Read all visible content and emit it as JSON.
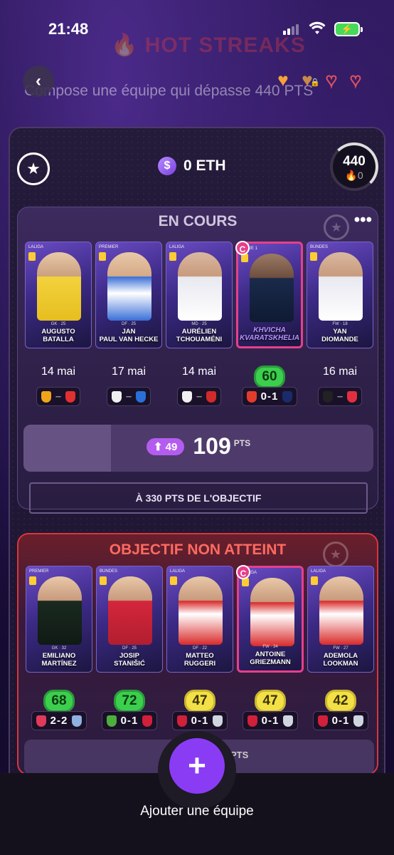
{
  "status_bar": {
    "time": "21:48"
  },
  "header": {
    "mode_title": "🔥 HOT STREAKS",
    "subtitle": "Compose une équipe qui dépasse 440 PTS"
  },
  "hearts": [
    "full",
    "half-locked",
    "empty",
    "empty"
  ],
  "panel": {
    "balance": "0 ETH",
    "gauge_score": "440",
    "gauge_streak": "🔥0"
  },
  "team1": {
    "status": "EN COURS",
    "cards": [
      {
        "name": "AUGUSTO\nBATALLA",
        "league": "LALIGA",
        "meta": "GK · 25",
        "photo": "yellow",
        "captain": false
      },
      {
        "name": "JAN\nPAUL VAN HECKE",
        "league": "PREMIER",
        "meta": "DF · 25",
        "photo": "blue",
        "captain": false
      },
      {
        "name": "AURÉLIEN\nTCHOUAMÉNI",
        "league": "LALIGA",
        "meta": "MD · 25",
        "photo": "white",
        "captain": false
      },
      {
        "name": "KHVICHA\nKVARATSKHELIA",
        "league": "LIGUE 1",
        "meta": "",
        "photo": "dark",
        "captain": true
      },
      {
        "name": "YAN\nDIOMANDE",
        "league": "BUNDES",
        "meta": "FW · 18",
        "photo": "white",
        "captain": false
      }
    ],
    "results": [
      {
        "type": "date",
        "value": "14 mai"
      },
      {
        "type": "date",
        "value": "17 mai"
      },
      {
        "type": "date",
        "value": "14 mai"
      },
      {
        "type": "score-green",
        "value": "60"
      },
      {
        "type": "date",
        "value": "16 mai"
      }
    ],
    "matches": [
      {
        "home": "#f2a51a",
        "away": "#e03030",
        "score": ""
      },
      {
        "home": "#f0f0f0",
        "away": "#2a6fd8",
        "score": ""
      },
      {
        "home": "#f0f0f0",
        "away": "#d02a2a",
        "score": ""
      },
      {
        "home": "#e33c2c",
        "away": "#1a2b6b",
        "score": "0-1"
      },
      {
        "home": "#222222",
        "away": "#e03040",
        "score": ""
      }
    ],
    "points_delta": "49",
    "points_total": "109",
    "points_unit": "PTS",
    "points_progress_pct": 25,
    "objective_text": "À 330 PTS DE L'OBJECTIF"
  },
  "team2": {
    "status": "OBJECTIF NON ATTEINT",
    "cards": [
      {
        "name": "EMILIANO\nMARTÍNEZ",
        "league": "PREMIER",
        "meta": "GK · 32",
        "photo": "green",
        "captain": false
      },
      {
        "name": "JOSIP\nSTANIŠIĆ",
        "league": "BUNDES",
        "meta": "DF · 25",
        "photo": "redsolid",
        "captain": false
      },
      {
        "name": "MATTEO\nRUGGERI",
        "league": "LALIGA",
        "meta": "DF · 22",
        "photo": "red",
        "captain": false
      },
      {
        "name": "ANTOINE\nGRIEZMANN",
        "league": "LALIGA",
        "meta": "FW · 34",
        "photo": "red",
        "captain": true
      },
      {
        "name": "ADEMOLA\nLOOKMAN",
        "league": "LALIGA",
        "meta": "FW · 27",
        "photo": "red",
        "captain": false
      }
    ],
    "scores": [
      {
        "color": "green",
        "value": "68"
      },
      {
        "color": "green",
        "value": "72"
      },
      {
        "color": "yellow",
        "value": "47"
      },
      {
        "color": "yellow",
        "value": "47"
      },
      {
        "color": "yellow",
        "value": "42"
      }
    ],
    "matches": [
      {
        "home": "#e03a5a",
        "away": "#8fb0e0",
        "score": "2-2"
      },
      {
        "home": "#4cae3c",
        "away": "#d0203a",
        "score": "0-1"
      },
      {
        "home": "#d0203a",
        "away": "#cfd6e0",
        "score": "0-1"
      },
      {
        "home": "#d0203a",
        "away": "#cfd6e0",
        "score": "0-1"
      },
      {
        "home": "#d0203a",
        "away": "#cfd6e0",
        "score": "0-1"
      }
    ],
    "points_unit": "PTS"
  },
  "add_team_label": "Ajouter une équipe",
  "colors": {
    "accent": "#8a3cf5",
    "captain": "#e63f8c",
    "fail": "#d9363d"
  }
}
